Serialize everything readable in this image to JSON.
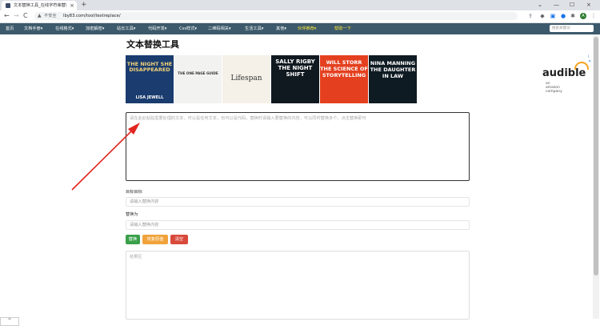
{
  "browser": {
    "tab_title": "文本替换工具_在线字符串替换工",
    "tab_close": "×",
    "new_tab": "+",
    "win_collapse": "⌄",
    "win_minimize": "—",
    "win_maximize": "☐",
    "win_close": "×",
    "back": "←",
    "forward": "→",
    "reload": "C",
    "lock": "▲",
    "security_text": "不安全",
    "url": "lby83.com/tool/textreplace/",
    "avatar_letter": "A",
    "toolbar_icons": [
      "extensions-icon",
      "translate-icon",
      "profile-icon",
      "puzzle-icon",
      "menu-icon"
    ]
  },
  "nav": {
    "items": [
      {
        "label": "首页",
        "highlight": false
      },
      {
        "label": "文档手册▾",
        "highlight": false
      },
      {
        "label": "在线格式▾",
        "highlight": false
      },
      {
        "label": "加密解密▾",
        "highlight": false
      },
      {
        "label": "站长工具▾",
        "highlight": false
      },
      {
        "label": "代码开发▾",
        "highlight": false
      },
      {
        "label": "Css样式▾",
        "highlight": false
      },
      {
        "label": "二维码相关▾",
        "highlight": false
      },
      {
        "label": "生活工具▾",
        "highlight": false
      },
      {
        "label": "其他▾",
        "highlight": false
      },
      {
        "label": "伙伴推荐▾",
        "highlight": true
      },
      {
        "label": "帮助一下",
        "highlight": true
      }
    ],
    "search_placeholder": "搜索关键词"
  },
  "page": {
    "title": "文本替换工具",
    "ad_info": "i ✕",
    "audible": "audible",
    "audible_sub": "an amazon company",
    "books": [
      {
        "title": "THE NIGHT SHE DISAPPEARED",
        "author": "LISA JEWELL",
        "bg": "#1a3c6e",
        "fg": "#f3d37a"
      },
      {
        "title": "THE ONE PAGE GUIDE",
        "author": "",
        "bg": "#f2f2f0",
        "fg": "#333333"
      },
      {
        "title": "Lifespan",
        "author": "",
        "bg": "#f5f1e8",
        "fg": "#333333"
      },
      {
        "title": "SALLY RIGBY THE NIGHT SHIFT",
        "author": "",
        "bg": "#101820",
        "fg": "#ffffff"
      },
      {
        "title": "WILL STORR THE SCIENCE OF STORYTELLING",
        "author": "",
        "bg": "#e4401f",
        "fg": "#ffffff"
      },
      {
        "title": "NINA MANNING THE DAUGHTER IN LAW",
        "author": "",
        "bg": "#0f1b22",
        "fg": "#ffffff"
      }
    ],
    "main_placeholder": "请在此处粘贴需要处理的文本，可以是任何文本，也可以是代码，替换时请输入要替换的内容，可以同时替换多个，点击替换即可",
    "target_label": "目标目标",
    "target_placeholder": "请输入替换内容",
    "replace_label": "替换为",
    "replace_placeholder": "请输入替换内容",
    "btn_replace": "替换",
    "btn_restore": "恢复原值",
    "btn_clear": "清空",
    "result_placeholder": "结果区",
    "bottom_arrow": "^"
  },
  "colors": {
    "nav_bg": "#3c5a6b",
    "btn_green": "#3aa04a",
    "btn_orange": "#f1a33b",
    "btn_red": "#d84a3b",
    "arrow": "#e2251f"
  }
}
